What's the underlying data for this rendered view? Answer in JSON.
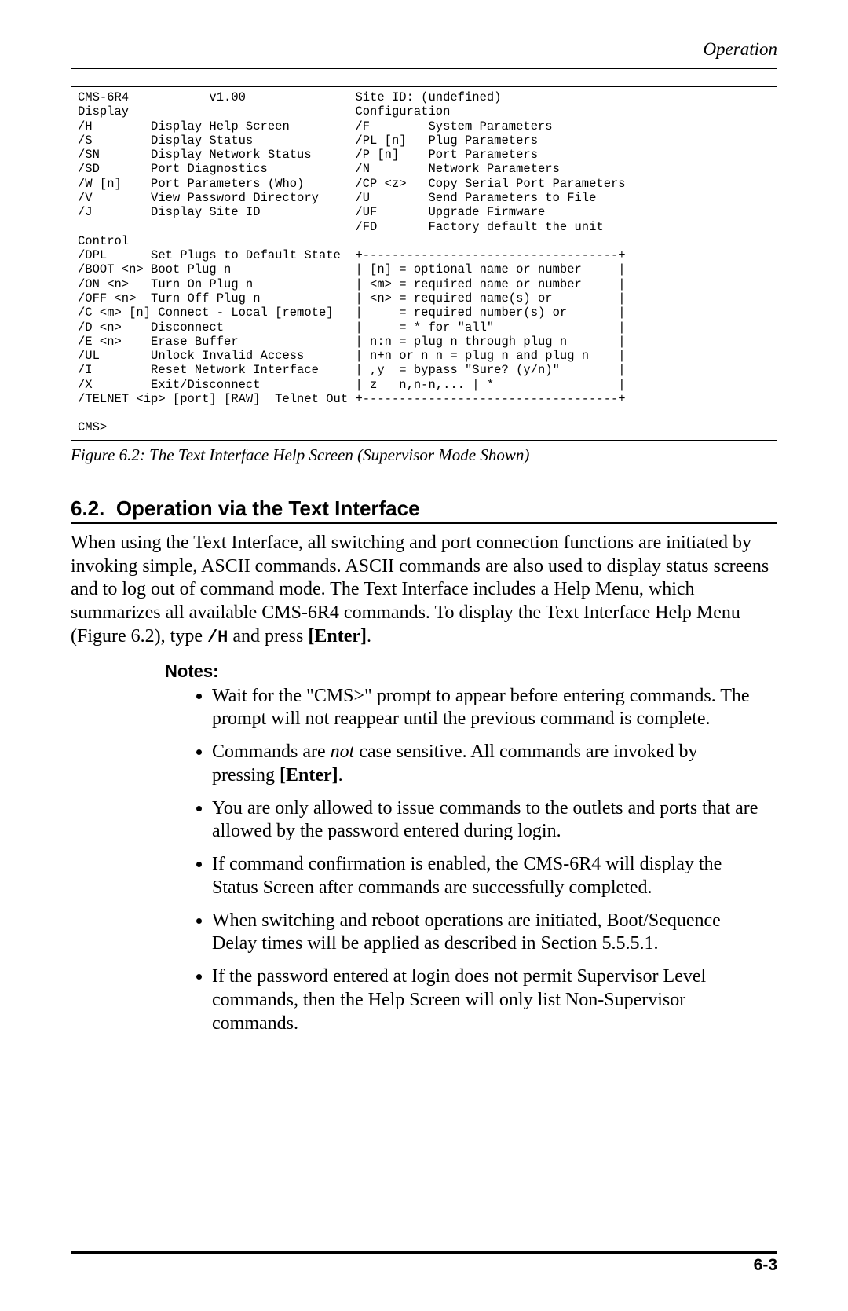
{
  "header": {
    "title": "Operation"
  },
  "code_block": "CMS-6R4           v1.00               Site ID: (undefined)\nDisplay                               Configuration\n/H        Display Help Screen         /F        System Parameters\n/S        Display Status              /PL [n]   Plug Parameters\n/SN       Display Network Status      /P [n]    Port Parameters\n/SD       Port Diagnostics            /N        Network Parameters\n/W [n]    Port Parameters (Who)       /CP <z>   Copy Serial Port Parameters\n/V        View Password Directory     /U        Send Parameters to File\n/J        Display Site ID             /UF       Upgrade Firmware\n                                      /FD       Factory default the unit\nControl\n/DPL      Set Plugs to Default State  +-----------------------------------+\n/BOOT <n> Boot Plug n                 | [n] = optional name or number     |\n/ON <n>   Turn On Plug n              | <m> = required name or number     |\n/OFF <n>  Turn Off Plug n             | <n> = required name(s) or         |\n/C <m> [n] Connect - Local [remote]   |     = required number(s) or       |\n/D <n>    Disconnect                  |     = * for \"all\"                 |\n/E <n>    Erase Buffer                | n:n = plug n through plug n       |\n/UL       Unlock Invalid Access       | n+n or n n = plug n and plug n    |\n/I        Reset Network Interface     | ,y  = bypass \"Sure? (y/n)\"        |\n/X        Exit/Disconnect             | z   n,n-n,... | *                 |\n/TELNET <ip> [port] [RAW]  Telnet Out +-----------------------------------+\n\nCMS>",
  "caption": "Figure 6.2:  The Text Interface Help Screen (Supervisor Mode Shown)",
  "section": {
    "number": "6.2.",
    "title": "Operation via the Text Interface"
  },
  "body": {
    "p1a": "When using the Text Interface, all switching and port connection functions are initiated by invoking simple, ASCII commands.  ASCII commands are also used to display status screens and to log out of command mode.  The Text Interface includes a Help Menu, which summarizes all available CMS-6R4 commands.  To display the Text Interface Help Menu (Figure 6.2), type ",
    "cmd": "/H",
    "p1b": " and press ",
    "enter": "[Enter]",
    "p1c": "."
  },
  "notes_heading": "Notes:",
  "notes": {
    "n1": "Wait for the \"CMS>\" prompt to appear before entering commands.  The prompt will not reappear until the previous command is complete.",
    "n2a": "Commands are ",
    "n2i": "not",
    "n2b": " case sensitive.  All commands are invoked by pressing ",
    "n2enter": "[Enter]",
    "n2c": ".",
    "n3": "You are only allowed to issue commands to the outlets and ports that are allowed by the password entered during login.",
    "n4": "If command confirmation is enabled, the CMS-6R4 will display the Status Screen after commands are successfully completed.",
    "n5": "When switching and reboot operations are initiated, Boot/Sequence Delay times will be applied as described in Section 5.5.5.1.",
    "n6": "If the password entered at login does not permit Supervisor Level commands, then the Help Screen will only list Non-Supervisor commands."
  },
  "footer": {
    "page": "6-3"
  }
}
